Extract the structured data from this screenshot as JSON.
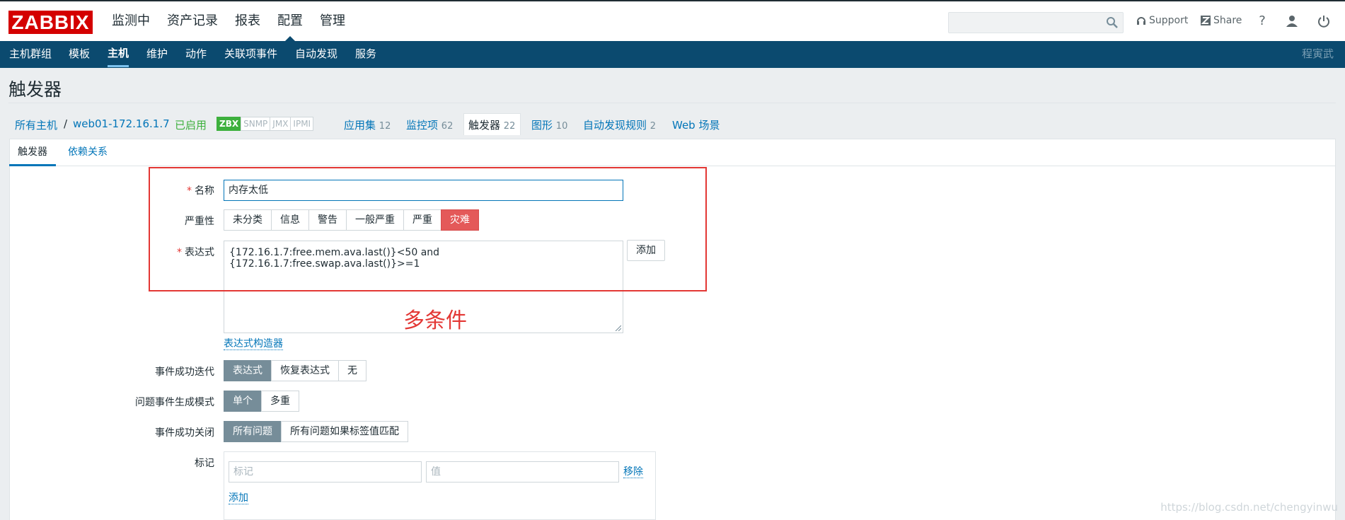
{
  "header": {
    "logo": "ZABBIX",
    "menu": [
      "监测中",
      "资产记录",
      "报表",
      "配置",
      "管理"
    ],
    "selected_menu": "配置",
    "support": "Support",
    "share": "Share",
    "help": "?"
  },
  "subnav": {
    "items": [
      "主机群组",
      "模板",
      "主机",
      "维护",
      "动作",
      "关联项事件",
      "自动发现",
      "服务"
    ],
    "selected": "主机",
    "user": "程寅武"
  },
  "page_title": "触发器",
  "breadcrumbs": {
    "all_hosts": "所有主机",
    "separator": "/",
    "host": "web01-172.16.1.7",
    "status": "已启用",
    "badges": [
      "ZBX",
      "SNMP",
      "JMX",
      "IPMI"
    ],
    "applications": "应用集",
    "applications_count": "12",
    "items": "监控项",
    "items_count": "62",
    "triggers": "触发器",
    "triggers_count": "22",
    "graphs": "图形",
    "graphs_count": "10",
    "discovery": "自动发现规则",
    "discovery_count": "2",
    "web": "Web 场景"
  },
  "tabs": [
    "触发器",
    "依赖关系"
  ],
  "form": {
    "name_label": "名称",
    "name_value": "内存太低",
    "severity_label": "严重性",
    "severities": [
      "未分类",
      "信息",
      "警告",
      "一般严重",
      "严重",
      "灾难"
    ],
    "severity_selected": "灾难",
    "expression_label": "表达式",
    "expression_value": "{172.16.1.7:free.mem.ava.last()}<50 and {172.16.1.7:free.swap.ava.last()}>=1",
    "add_button": "添加",
    "expression_builder": "表达式构造器",
    "ok_event_label": "事件成功迭代",
    "ok_event_options": [
      "表达式",
      "恢复表达式",
      "无"
    ],
    "ok_event_selected": "表达式",
    "problem_mode_label": "问题事件生成模式",
    "problem_mode_options": [
      "单个",
      "多重"
    ],
    "problem_mode_selected": "单个",
    "ok_close_label": "事件成功关闭",
    "ok_close_options": [
      "所有问题",
      "所有问题如果标签值匹配"
    ],
    "ok_close_selected": "所有问题",
    "tags_label": "标记",
    "tag_placeholder": "标记",
    "value_placeholder": "值",
    "remove_link": "移除",
    "add_link": "添加"
  },
  "annotation": "多条件",
  "watermark": "https://blog.csdn.net/chengyinwu"
}
